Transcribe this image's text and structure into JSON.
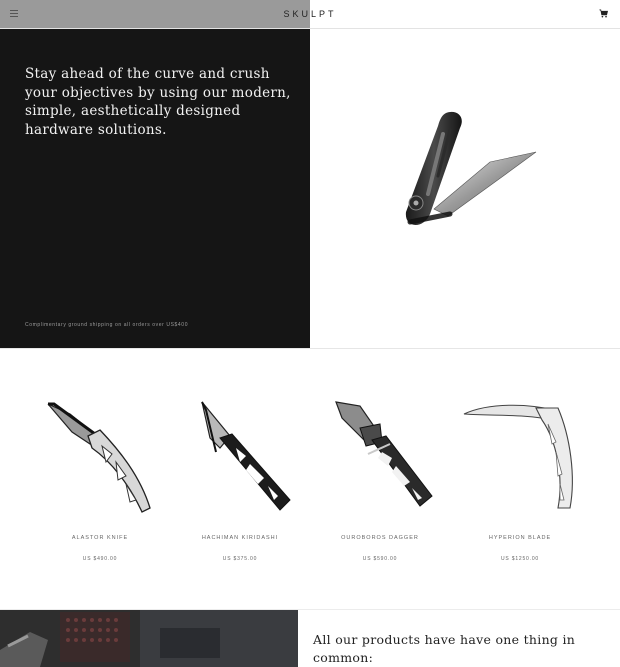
{
  "header": {
    "brand": "SKULPT",
    "menu_icon": "hamburger-menu-icon",
    "cart_icon": "shopping-cart-icon"
  },
  "hero": {
    "heading": "Stay ahead of the curve and crush your objectives by using our modern, simple, aesthetically designed hardware solutions.",
    "shipping_note": "Complimentary ground shipping on all orders over US$400",
    "image": "folding-knife-image"
  },
  "products": [
    {
      "name": "ALASTOR KNIFE",
      "price": "US $490.00",
      "image": "alastor-knife-image"
    },
    {
      "name": "HACHIMAN KIRIDASHI",
      "price": "US $375.00",
      "image": "hachiman-kiridashi-image"
    },
    {
      "name": "OUROBOROS DAGGER",
      "price": "US $590.00",
      "image": "ouroboros-dagger-image"
    },
    {
      "name": "HYPERION BLADE",
      "price": "US $1250.00",
      "image": "hyperion-blade-image"
    }
  ],
  "bottom": {
    "heading": "All our products have have one thing in common:"
  },
  "colors": {
    "hero_dark": "#151515",
    "header_gray": "#9a9a9a",
    "text_muted": "#666666"
  }
}
